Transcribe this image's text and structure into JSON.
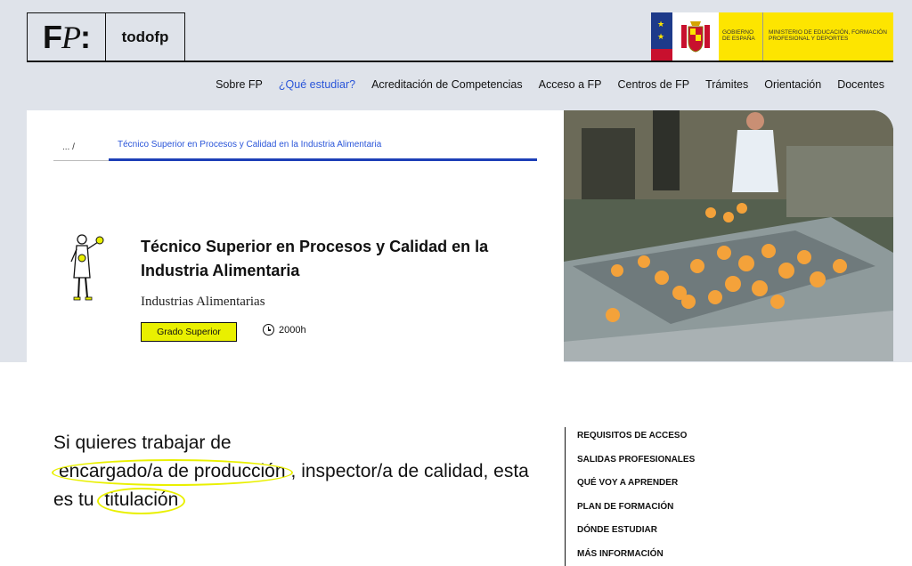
{
  "logo": {
    "mark_left": "F",
    "mark_mid": "P",
    "mark_right": ":",
    "name": "todofp"
  },
  "gov": {
    "gobierno": "GOBIERNO DE ESPAÑA",
    "ministerio": "MINISTERIO DE EDUCACIÓN, FORMACIÓN PROFESIONAL Y DEPORTES"
  },
  "nav": [
    {
      "label": "Sobre FP",
      "active": false
    },
    {
      "label": "¿Qué estudiar?",
      "active": true
    },
    {
      "label": "Acreditación de Competencias",
      "active": false
    },
    {
      "label": "Acceso a FP",
      "active": false
    },
    {
      "label": "Centros de FP",
      "active": false
    },
    {
      "label": "Trámites",
      "active": false
    },
    {
      "label": "Orientación",
      "active": false
    },
    {
      "label": "Docentes",
      "active": false
    }
  ],
  "breadcrumb": {
    "ellipsis": "... /",
    "current": "Técnico Superior en Procesos y Calidad en la Industria Alimentaria"
  },
  "hero": {
    "title": "Técnico Superior en Procesos y Calidad en la Industria Alimentaria",
    "family": "Industrias Alimentarias",
    "badge": "Grado Superior",
    "hours": "2000h"
  },
  "lead": {
    "part1": "Si quieres trabajar de",
    "highlight1": "encargado/a de producción",
    "part2": ", inspector/a de calidad, esta es tu",
    "highlight2": "titulación"
  },
  "toc": [
    "REQUISITOS DE ACCESO",
    "SALIDAS PROFESIONALES",
    "QUÉ VOY A APRENDER",
    "PLAN DE FORMACIÓN",
    "DÓNDE ESTUDIAR",
    "MÁS INFORMACIÓN"
  ],
  "colors": {
    "accent_blue": "#2a55d9",
    "highlight_yellow": "#e9f000",
    "band": "#dfe3ea"
  }
}
